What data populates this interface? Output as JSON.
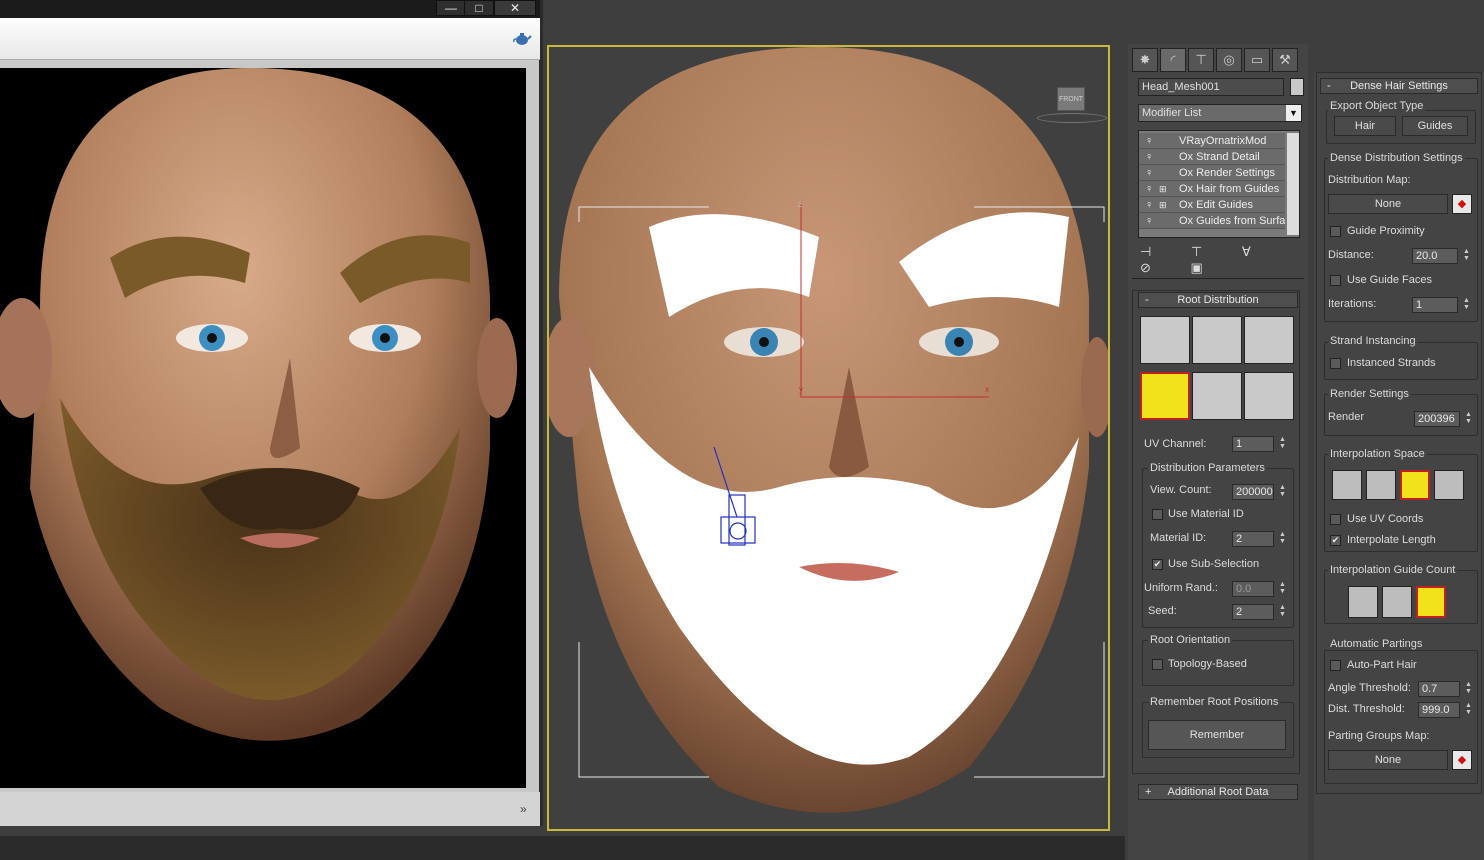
{
  "render_window": {
    "title_buttons": [
      "—",
      "□",
      "✕"
    ],
    "toolbar_icon": "teapot-icon",
    "scroll_icon": "chevron-down-icon"
  },
  "viewport": {
    "viewcube_label": "FRONT",
    "gizmo_axes": {
      "z": "z",
      "y": "y",
      "x": "x"
    }
  },
  "command_panel": {
    "tabs": [
      "create-icon",
      "modify-icon",
      "hierarchy-icon",
      "motion-icon",
      "display-icon",
      "utilities-icon"
    ],
    "object_name": "Head_Mesh001",
    "modifier_list_label": "Modifier List",
    "stack": [
      {
        "label": "VRayOrnatrixMod",
        "expand": false
      },
      {
        "label": "Ox Strand Detail",
        "expand": false
      },
      {
        "label": "Ox Render Settings",
        "expand": false
      },
      {
        "label": "Ox Hair from Guides",
        "expand": true
      },
      {
        "label": "Ox Edit Guides",
        "expand": true
      },
      {
        "label": "Ox Guides from Surfa",
        "expand": false
      }
    ],
    "root_distribution": {
      "title": "Root Distribution",
      "uv_channel_label": "UV Channel:",
      "uv_channel_value": "1",
      "dist_params_title": "Distribution Parameters",
      "view_count_label": "View. Count:",
      "view_count_value": "200000",
      "use_material_id_label": "Use Material ID",
      "material_id_label": "Material ID:",
      "material_id_value": "2",
      "use_sub_selection_label": "Use Sub-Selection",
      "uniform_rand_label": "Uniform Rand.:",
      "uniform_rand_value": "0.0",
      "seed_label": "Seed:",
      "seed_value": "2",
      "root_orientation_title": "Root Orientation",
      "topology_based_label": "Topology-Based",
      "remember_root_title": "Remember Root Positions",
      "remember_button": "Remember"
    },
    "additional_root_data": "Additional Root Data"
  },
  "dense_hair": {
    "title": "Dense Hair Settings",
    "export_type_title": "Export Object Type",
    "hair_button": "Hair",
    "guides_button": "Guides",
    "dense_dist_title": "Dense Distribution Settings",
    "distribution_map_label": "Distribution Map:",
    "distribution_map_value": "None",
    "guide_proximity_label": "Guide Proximity",
    "distance_label": "Distance:",
    "distance_value": "20.0",
    "use_guide_faces_label": "Use Guide Faces",
    "iterations_label": "Iterations:",
    "iterations_value": "1",
    "strand_instancing_title": "Strand Instancing",
    "instanced_strands_label": "Instanced Strands",
    "render_settings_title": "Render Settings",
    "render_label": "Render",
    "render_value": "200396",
    "interp_space_title": "Interpolation Space",
    "use_uv_coords_label": "Use UV Coords",
    "interpolate_length_label": "Interpolate Length",
    "interp_guide_count_title": "Interpolation Guide Count",
    "auto_partings_title": "Automatic Partings",
    "auto_part_hair_label": "Auto-Part Hair",
    "angle_threshold_label": "Angle Threshold:",
    "angle_threshold_value": "0.7",
    "dist_threshold_label": "Dist. Threshold:",
    "dist_threshold_value": "999.0",
    "parting_groups_map_label": "Parting Groups Map:",
    "parting_groups_map_value": "None"
  },
  "colors": {
    "viewport_border": "#c9b93a",
    "selected_thumb": "#f2e21a",
    "skin": "#b88a68",
    "beard_render": "#6b4a22",
    "beard_viewport": "#ffffff"
  }
}
